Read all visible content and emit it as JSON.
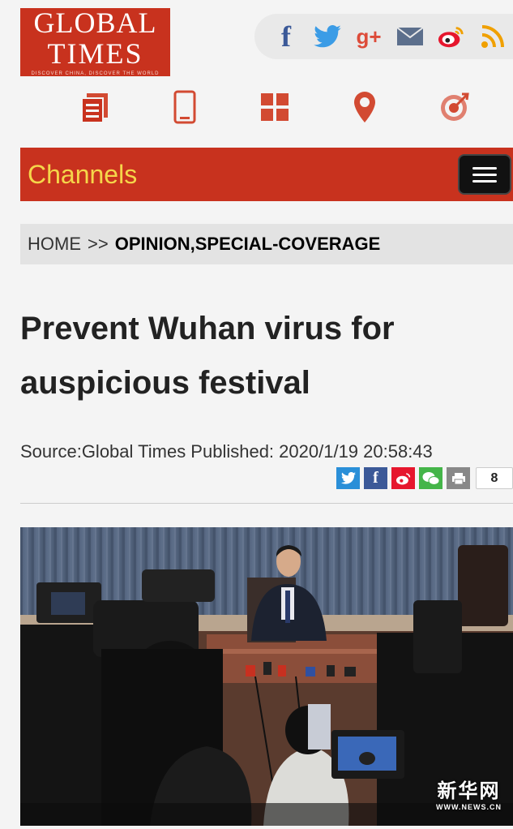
{
  "logo": {
    "line1": "GLOBAL",
    "line2": "TIMES",
    "tagline": "DISCOVER CHINA, DISCOVER THE WORLD",
    "color": "#c8321e"
  },
  "social": [
    {
      "name": "facebook-icon",
      "glyph": "f"
    },
    {
      "name": "twitter-icon",
      "glyph": "🐦"
    },
    {
      "name": "google-plus-icon",
      "glyph": "g+"
    },
    {
      "name": "mail-icon",
      "glyph": "✉"
    },
    {
      "name": "weibo-icon",
      "glyph": "◉"
    },
    {
      "name": "rss-icon",
      "glyph": ")))"
    }
  ],
  "nav_icons": [
    "documents-icon",
    "mobile-icon",
    "grid-icon",
    "location-icon",
    "target-icon"
  ],
  "channels": {
    "label": "Channels"
  },
  "breadcrumb": {
    "home": "HOME",
    "separator": ">>",
    "section": "OPINION",
    "section2": "SPECIAL-COVERAGE"
  },
  "article": {
    "title": "Prevent Wuhan virus for auspicious festival",
    "source": "Source:Global Times Published: 2020/1/19 20:58:43"
  },
  "share": {
    "count": "8"
  },
  "photo": {
    "watermark_cn": "新华网",
    "watermark_url": "WWW.NEWS.CN"
  }
}
